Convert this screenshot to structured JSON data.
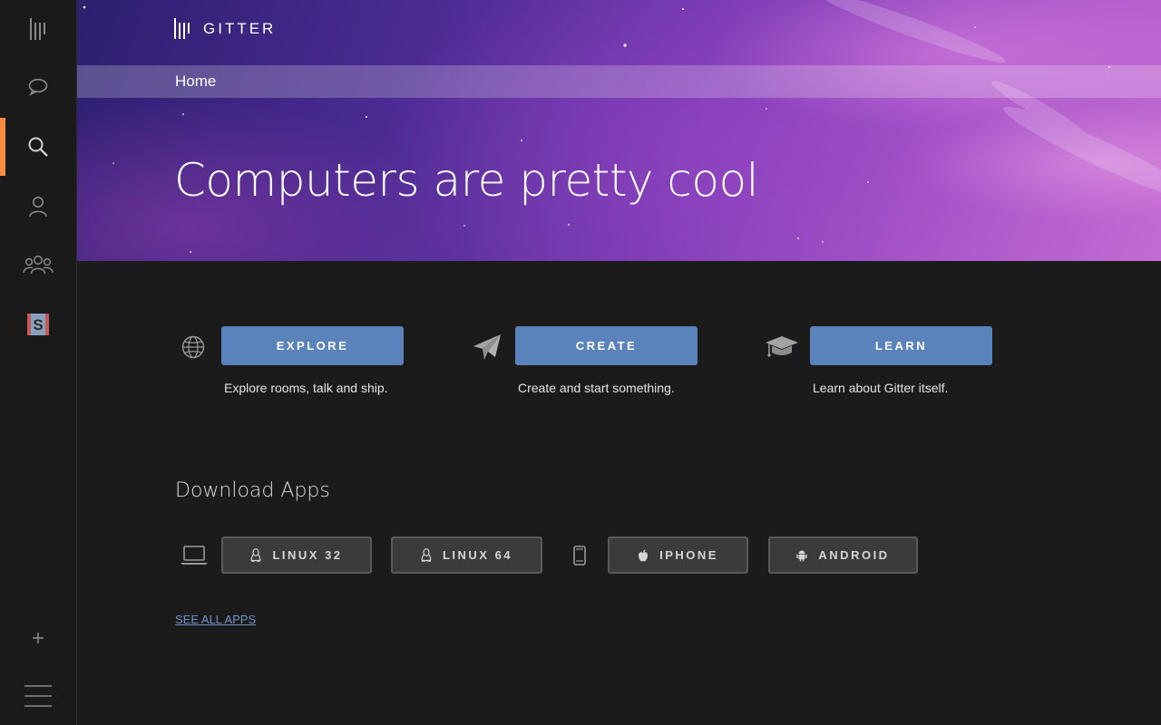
{
  "rail": {
    "items": [
      {
        "icon": "gitter-logo-icon"
      },
      {
        "icon": "chat-bubble-icon"
      },
      {
        "icon": "search-icon",
        "active": true
      },
      {
        "icon": "person-icon"
      },
      {
        "icon": "people-group-icon"
      },
      {
        "icon": "community-avatar-s-icon",
        "letter": "S"
      }
    ],
    "bottom": [
      {
        "icon": "plus-icon"
      },
      {
        "icon": "hamburger-menu-icon"
      }
    ]
  },
  "header": {
    "logo_text": "GITTER",
    "breadcrumb": "Home",
    "title": "Computers are pretty cool"
  },
  "actions": [
    {
      "icon": "globe-icon",
      "label": "EXPLORE",
      "description": "Explore rooms, talk and ship."
    },
    {
      "icon": "paper-plane-icon",
      "label": "CREATE",
      "description": "Create and start something."
    },
    {
      "icon": "graduation-cap-icon",
      "label": "LEARN",
      "description": "Learn about Gitter itself."
    }
  ],
  "downloads": {
    "heading": "Download Apps",
    "desktop_icon": "laptop-icon",
    "mobile_icon": "phone-icon",
    "buttons": [
      {
        "icon": "linux-icon",
        "label": "LINUX 32"
      },
      {
        "icon": "linux-icon",
        "label": "LINUX 64"
      },
      {
        "icon": "apple-icon",
        "label": "IPHONE"
      },
      {
        "icon": "android-icon",
        "label": "ANDROID"
      }
    ],
    "see_all": "SEE ALL APPS"
  },
  "colors": {
    "accent_orange": "#f68d42",
    "button_blue": "#5b83bb",
    "link_blue": "#6f93c8",
    "background": "#1b1b1b"
  }
}
